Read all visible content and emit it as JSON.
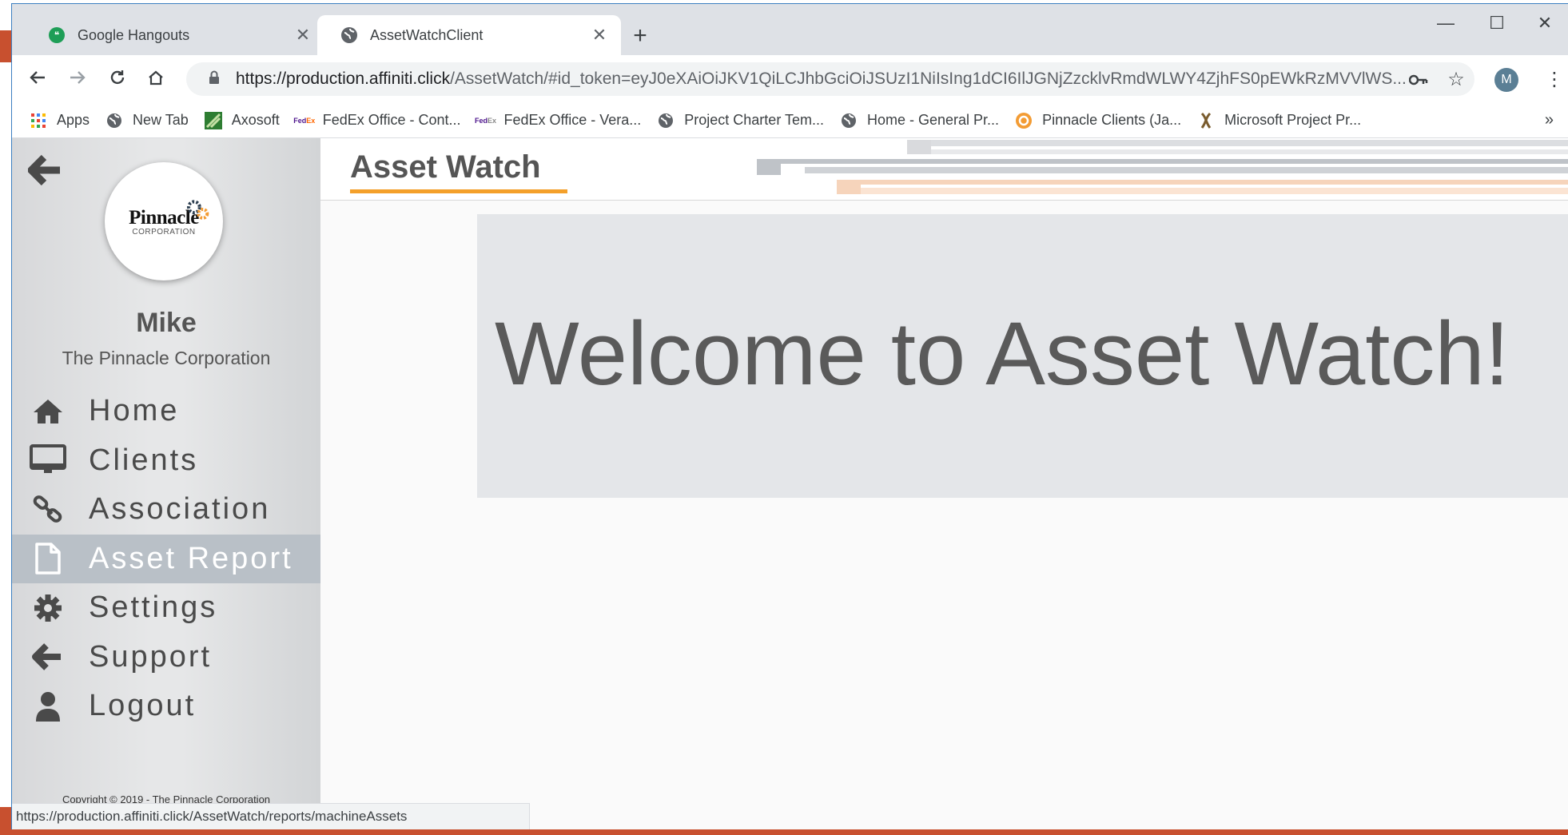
{
  "browser": {
    "tabs": [
      {
        "title": "Google Hangouts",
        "close": "✕"
      },
      {
        "title": "AssetWatchClient",
        "close": "✕"
      }
    ],
    "new_tab": "+",
    "window_controls": {
      "minimize": "—",
      "maximize": "☐",
      "close": "✕"
    },
    "url_host": "https://production.affiniti.click",
    "url_path": "/AssetWatch/#id_token=eyJ0eXAiOiJKV1QiLCJhbGciOiJSUzI1NiIsIng1dCI6IlJGNjZzcklvRmdWLWY4ZjhFS0pEWkRzMVVlWS...",
    "avatar_letter": "M",
    "bookmarks": [
      {
        "label": "Apps",
        "icon": "apps-grid-icon"
      },
      {
        "label": "New Tab",
        "icon": "globe-icon"
      },
      {
        "label": "Axosoft",
        "icon": "axosoft-icon"
      },
      {
        "label": "FedEx Office - Cont...",
        "icon": "fedex-icon"
      },
      {
        "label": "FedEx Office - Vera...",
        "icon": "fedex-icon"
      },
      {
        "label": "Project Charter Tem...",
        "icon": "globe-icon"
      },
      {
        "label": "Home - General Pr...",
        "icon": "globe-icon"
      },
      {
        "label": "Pinnacle Clients (Ja...",
        "icon": "pinnacle-icon"
      },
      {
        "label": "Microsoft Project Pr...",
        "icon": "ms-project-icon"
      }
    ],
    "bookmarks_more": "»",
    "status_url": "https://production.affiniti.click/AssetWatch/reports/machineAssets"
  },
  "sidebar": {
    "logo_text": "Pinnacle",
    "logo_sub": "CORPORATION",
    "user_name": "Mike",
    "org_name": "The Pinnacle Corporation",
    "nav": [
      {
        "label": "Home",
        "icon": "home-icon",
        "active": false
      },
      {
        "label": "Clients",
        "icon": "monitor-icon",
        "active": false
      },
      {
        "label": "Association",
        "icon": "link-icon",
        "active": false
      },
      {
        "label": "Asset Report",
        "icon": "file-icon",
        "active": true
      },
      {
        "label": "Settings",
        "icon": "gear-icon",
        "active": false
      },
      {
        "label": "Support",
        "icon": "arrow-left-icon",
        "active": false
      },
      {
        "label": "Logout",
        "icon": "user-icon",
        "active": false
      }
    ],
    "copyright": "Copyright © 2019 - The Pinnacle Corporation"
  },
  "main": {
    "title": "Asset Watch",
    "welcome": "Welcome to Asset Watch!"
  },
  "colors": {
    "accent": "#f4a02a",
    "active_nav": "#b9c0c7"
  }
}
